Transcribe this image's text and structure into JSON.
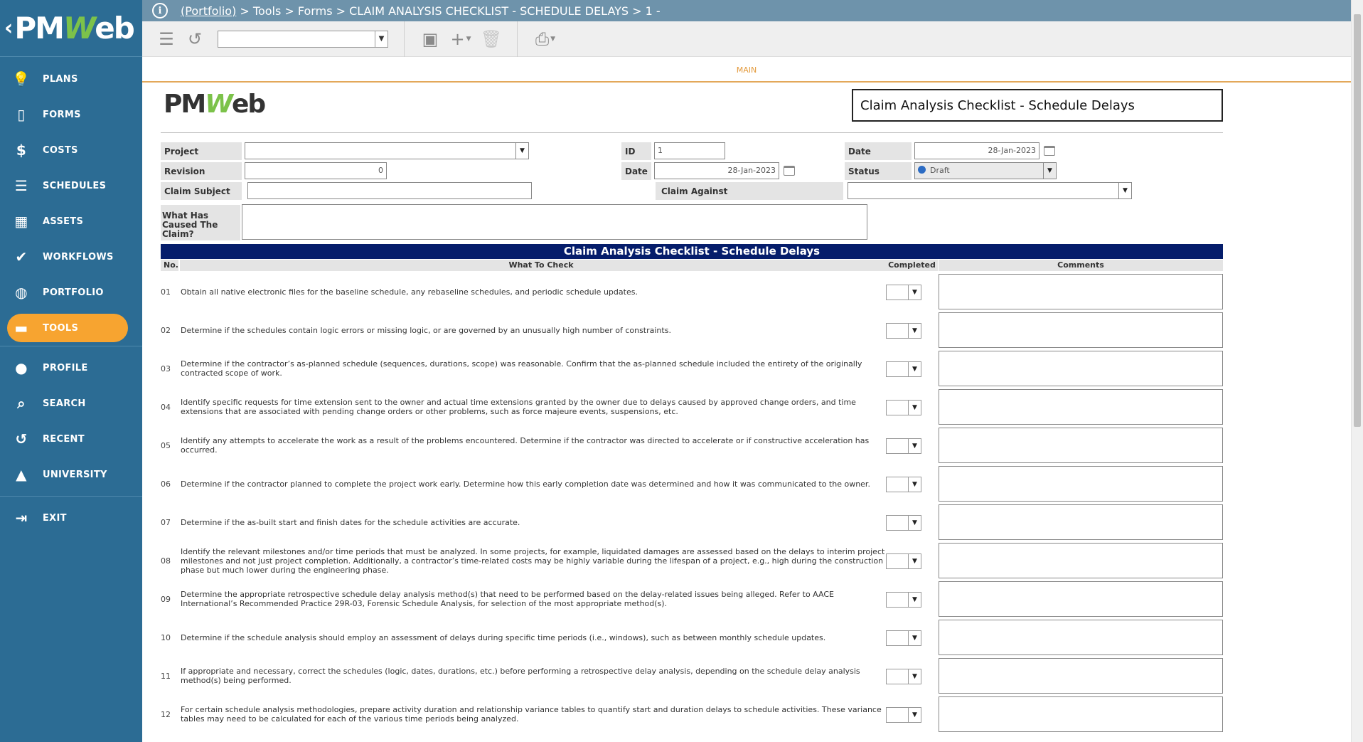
{
  "sidebar": {
    "logo": {
      "prefix": "PM",
      "w": "W",
      "suffix": "eb",
      "back": "‹"
    },
    "items": [
      {
        "label": "PLANS",
        "icon": "lightbulb-icon",
        "glyph": "💡"
      },
      {
        "label": "FORMS",
        "icon": "document-icon",
        "glyph": "▯"
      },
      {
        "label": "COSTS",
        "icon": "dollar-icon",
        "glyph": "$"
      },
      {
        "label": "SCHEDULES",
        "icon": "schedule-bars-icon",
        "glyph": "☰"
      },
      {
        "label": "ASSETS",
        "icon": "building-icon",
        "glyph": "▦"
      },
      {
        "label": "WORKFLOWS",
        "icon": "checkmark-icon",
        "glyph": "✔"
      },
      {
        "label": "PORTFOLIO",
        "icon": "globe-icon",
        "glyph": "◍"
      },
      {
        "label": "TOOLS",
        "icon": "briefcase-icon",
        "glyph": "▬"
      },
      {
        "label": "PROFILE",
        "icon": "user-icon",
        "glyph": "●"
      },
      {
        "label": "SEARCH",
        "icon": "search-icon",
        "glyph": "⌕"
      },
      {
        "label": "RECENT",
        "icon": "history-icon",
        "glyph": "↺"
      },
      {
        "label": "UNIVERSITY",
        "icon": "graduation-cap-icon",
        "glyph": "▲"
      },
      {
        "label": "EXIT",
        "icon": "exit-icon",
        "glyph": "⇥"
      }
    ]
  },
  "breadcrumb": {
    "portfolio": "(Portfolio)",
    "rest": " > Tools > Forms > CLAIM ANALYSIS CHECKLIST - SCHEDULE DELAYS > 1 -"
  },
  "toolbar": {
    "select_value": ""
  },
  "tab": {
    "label": "MAIN"
  },
  "form": {
    "logo": {
      "prefix": "PM",
      "w": "W",
      "suffix": "eb"
    },
    "title": "Claim Analysis Checklist - Schedule Delays",
    "fields": {
      "project_label": "Project",
      "project_value": "",
      "revision_label": "Revision",
      "revision_value": "0",
      "claim_subject_label": "Claim Subject",
      "claim_subject_value": "",
      "what_caused_label": "What Has Caused The Claim?",
      "what_caused_value": "",
      "id_label": "ID",
      "id_value": "1",
      "date1_label": "Date",
      "date1_value": "28-Jan-2023",
      "date2_label": "Date",
      "date2_value": "28-Jan-2023",
      "status_label": "Status",
      "status_value": "Draft",
      "claim_against_label": "Claim Against",
      "claim_against_value": ""
    },
    "section_title": "Claim Analysis Checklist - Schedule Delays",
    "columns": {
      "no": "No.",
      "what": "What To Check",
      "completed": "Completed",
      "comments": "Comments"
    },
    "rows": [
      {
        "no": "01",
        "text": "Obtain all native electronic files for the baseline schedule, any rebaseline schedules, and periodic schedule updates."
      },
      {
        "no": "02",
        "text": "Determine if the schedules contain logic errors or missing logic, or are governed by an unusually high number of constraints."
      },
      {
        "no": "03",
        "text": "Determine if the contractor’s as-planned schedule (sequences, durations, scope) was reasonable. Confirm that the as-planned schedule included the entirety of the originally contracted scope of work."
      },
      {
        "no": "04",
        "text": "Identify specific requests for time extension sent to the owner and actual time extensions granted by the owner due to delays caused by approved change orders, and time extensions that are associated with pending change orders or other problems, such as force majeure events, suspensions, etc."
      },
      {
        "no": "05",
        "text": "Identify any attempts to accelerate the work as a result of the problems encountered. Determine if the contractor was directed to accelerate or if constructive acceleration has occurred."
      },
      {
        "no": "06",
        "text": "Determine if the contractor planned to complete the project work early. Determine how this early completion date was determined and how it was communicated to the owner."
      },
      {
        "no": "07",
        "text": "Determine if the as-built start and finish dates for the schedule activities are accurate."
      },
      {
        "no": "08",
        "text": "Identify the relevant milestones and/or time periods that must be analyzed. In some projects, for example, liquidated damages are assessed based on the delays to interim project milestones and not just project completion. Additionally, a contractor’s time-related costs may be highly variable during the lifespan of a project, e.g., high during the construction phase but much lower during the engineering phase."
      },
      {
        "no": "09",
        "text": "Determine the appropriate retrospective schedule delay analysis method(s) that need to be performed based on the delay-related issues being alleged. Refer to AACE International’s Recommended Practice 29R-03, Forensic Schedule Analysis, for selection of the most appropriate method(s)."
      },
      {
        "no": "10",
        "text": "Determine if the schedule analysis should employ an assessment of delays during specific time periods (i.e., windows), such as between monthly schedule updates."
      },
      {
        "no": "11",
        "text": "If appropriate and necessary, correct the schedules (logic, dates, durations, etc.) before performing a retrospective delay analysis, depending on the schedule delay analysis method(s) being performed."
      },
      {
        "no": "12",
        "text": "For certain schedule analysis methodologies, prepare activity duration and relationship variance tables to quantify start and duration delays to schedule activities. These variance tables may need to be calculated for each of the various time periods being analyzed."
      }
    ]
  }
}
